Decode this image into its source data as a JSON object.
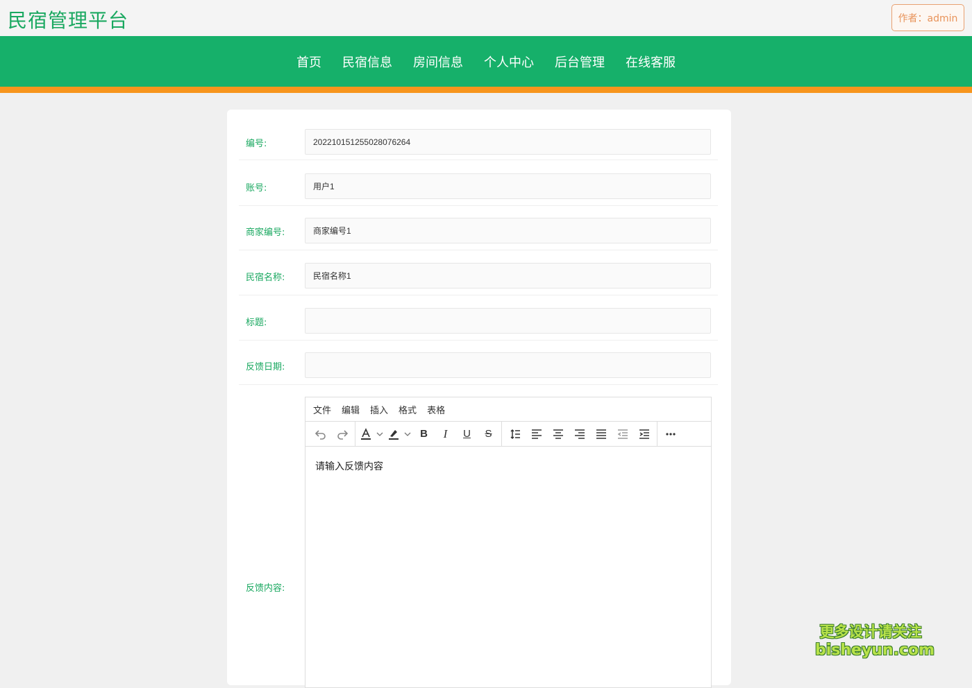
{
  "header": {
    "site_title": "民宿管理平台",
    "author_badge": "作者：admin"
  },
  "nav": {
    "items": [
      "首页",
      "民宿信息",
      "房间信息",
      "个人中心",
      "后台管理",
      "在线客服"
    ]
  },
  "form": {
    "fields": [
      {
        "label": "编号:",
        "value": "20221015125502807626 4"
      },
      {
        "label": "账号:",
        "value": "用户1"
      },
      {
        "label": "商家编号:",
        "value": "商家编号1"
      },
      {
        "label": "民宿名称:",
        "value": "民宿名称1"
      },
      {
        "label": "标题:",
        "value": ""
      },
      {
        "label": "反馈日期:",
        "value": ""
      }
    ],
    "content_label": "反馈内容:"
  },
  "editor": {
    "menus": [
      "文件",
      "编辑",
      "插入",
      "格式",
      "表格"
    ],
    "placeholder": "请输入反馈内容"
  },
  "watermark": {
    "line1": "更多设计请关注",
    "line2": "bisheyun.com"
  },
  "colors": {
    "brand_green": "#16b06a",
    "accent_orange": "#f7951d",
    "label_green": "#1aa860"
  }
}
